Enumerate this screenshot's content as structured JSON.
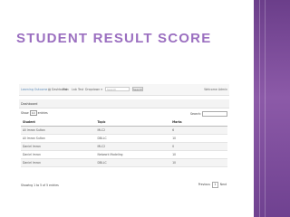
{
  "slide": {
    "title": "STUDENT RESULT SCORE"
  },
  "navbar": {
    "brand": "Learning Outcome",
    "items": [
      "Dashboard",
      "Plan",
      "Lab",
      "Test",
      "Dropdown"
    ],
    "search_placeholder": "Search",
    "search_button": "Search",
    "user": "Welcome Admin"
  },
  "dashboard": {
    "title": "Dashboard"
  },
  "table_controls": {
    "show_label": "Show",
    "entries_value": "10",
    "entries_label": "entries",
    "search_label": "Search:"
  },
  "table": {
    "headers": [
      "Student",
      "Topic",
      "Marks"
    ],
    "rows": [
      [
        "Ali Imran Sultan",
        "MLC2",
        "6"
      ],
      [
        "Ali Imran Sultan",
        "DBLLC",
        "10"
      ],
      [
        "Daniel Imran",
        "MLC2",
        "0"
      ],
      [
        "Daniel Imran",
        "Network Modeling",
        "10"
      ],
      [
        "Daniel Imran",
        "DBLLC",
        "10"
      ]
    ]
  },
  "footer": {
    "info": "Showing 1 to 5 of 5 entries",
    "prev": "Previous",
    "page": "1",
    "next": "Next"
  }
}
